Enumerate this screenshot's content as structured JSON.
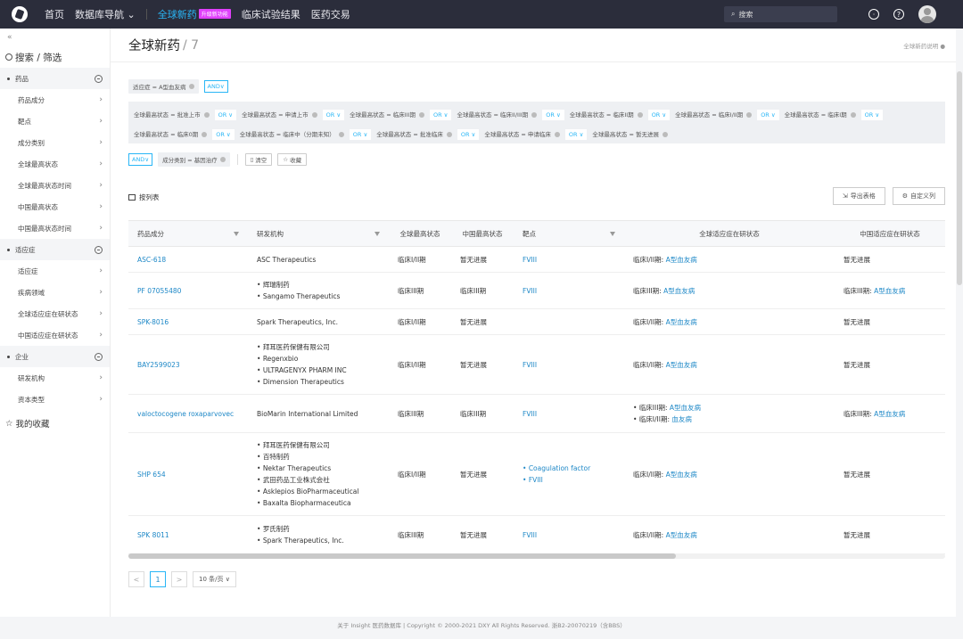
{
  "topnav": {
    "home": "首页",
    "db_nav": "数据库导航",
    "global_drugs": "全球新药",
    "upgrade_badge": "升级新功能",
    "clinical_results": "临床试验结果",
    "deals": "医药交易",
    "search_placeholder": "搜索"
  },
  "sidebar": {
    "collapse": "«",
    "search_title": "搜索 / 筛选",
    "groups": [
      {
        "label": "药品",
        "items": [
          "药品成分",
          "靶点",
          "成分类别",
          "全球最高状态",
          "全球最高状态时间",
          "中国最高状态",
          "中国最高状态时间"
        ]
      },
      {
        "label": "适应症",
        "items": [
          "适应症",
          "疾病领域",
          "全球适应症在研状态",
          "中国适应症在研状态"
        ]
      },
      {
        "label": "企业",
        "items": [
          "研发机构",
          "资本类型"
        ]
      }
    ],
    "favorites": "我的收藏"
  },
  "main": {
    "title": "全球新药",
    "count": "/ 7",
    "help": "全球新药说明",
    "filters": {
      "indication_chip": "适应症 = A型血友病",
      "and1": "AND",
      "status_chips": [
        "全球最高状态 = 批准上市",
        "全球最高状态 = 申请上市",
        "全球最高状态 = 临床III期",
        "全球最高状态 = 临床II/III期",
        "全球最高状态 = 临床II期",
        "全球最高状态 = 临床I/II期",
        "全球最高状态 = 临床I期",
        "全球最高状态 = 临床0期",
        "全球最高状态 = 临床中（分期未知）",
        "全球最高状态 = 批准临床",
        "全球最高状态 = 申请临床",
        "全球最高状态 = 暂无进展"
      ],
      "or_label": "OR",
      "and2": "AND",
      "category_chip": "成分类别 = 基因治疗",
      "clear": "清空",
      "save": "收藏"
    },
    "list_title": "按列表",
    "export": "导出表格",
    "customize": "自定义列",
    "columns": [
      "药品成分",
      "研发机构",
      "全球最高状态",
      "中国最高状态",
      "靶点",
      "全球适应症在研状态",
      "中国适应症在研状态"
    ],
    "rows": [
      {
        "drug": "ASC-618",
        "orgs": [
          "ASC Therapeutics"
        ],
        "global": "临床I/II期",
        "china": "暂无进展",
        "targets": [
          "FVIII"
        ],
        "gstatus": [
          {
            "phase": "临床I/II期:",
            "ind": "A型血友病"
          }
        ],
        "cstatus": {
          "phase": "暂无进展",
          "ind": ""
        }
      },
      {
        "drug": "PF 07055480",
        "orgs": [
          "辉瑞制药",
          "Sangamo Therapeutics"
        ],
        "global": "临床III期",
        "china": "临床III期",
        "targets": [
          "FVIII"
        ],
        "gstatus": [
          {
            "phase": "临床III期:",
            "ind": "A型血友病"
          }
        ],
        "cstatus": {
          "phase": "临床III期:",
          "ind": "A型血友病"
        }
      },
      {
        "drug": "SPK-8016",
        "orgs": [
          "Spark Therapeutics, Inc."
        ],
        "global": "临床I/II期",
        "china": "暂无进展",
        "targets": [],
        "gstatus": [
          {
            "phase": "临床I/II期:",
            "ind": "A型血友病"
          }
        ],
        "cstatus": {
          "phase": "暂无进展",
          "ind": ""
        }
      },
      {
        "drug": "BAY2599023",
        "orgs": [
          "拜耳医药保健有限公司",
          "Regenxbio",
          "ULTRAGENYX PHARM INC",
          "Dimension Therapeutics"
        ],
        "global": "临床I/II期",
        "china": "暂无进展",
        "targets": [
          "FVIII"
        ],
        "gstatus": [
          {
            "phase": "临床I/II期:",
            "ind": "A型血友病"
          }
        ],
        "cstatus": {
          "phase": "暂无进展",
          "ind": ""
        }
      },
      {
        "drug": "valoctocogene roxaparvovec",
        "orgs": [
          "BioMarin International Limited"
        ],
        "global": "临床III期",
        "china": "临床III期",
        "targets": [
          "FVIII"
        ],
        "gstatus": [
          {
            "phase": "临床III期:",
            "ind": "A型血友病"
          },
          {
            "phase": "临床I/II期:",
            "ind": "血友病"
          }
        ],
        "cstatus": {
          "phase": "临床III期:",
          "ind": "A型血友病"
        }
      },
      {
        "drug": "SHP 654",
        "orgs": [
          "拜耳医药保健有限公司",
          "百特制药",
          "Nektar Therapeutics",
          "武田药品工业株式会社",
          "Asklepios BioPharmaceutical",
          "Baxalta Biopharmaceutica"
        ],
        "global": "临床I/II期",
        "china": "暂无进展",
        "targets": [
          "Coagulation factor",
          "FVIII"
        ],
        "gstatus": [
          {
            "phase": "临床I/II期:",
            "ind": "A型血友病"
          }
        ],
        "cstatus": {
          "phase": "暂无进展",
          "ind": ""
        }
      },
      {
        "drug": "SPK 8011",
        "orgs": [
          "罗氏制药",
          "Spark Therapeutics, Inc."
        ],
        "global": "临床III期",
        "china": "暂无进展",
        "targets": [
          "FVIII"
        ],
        "gstatus": [
          {
            "phase": "临床I/II期:",
            "ind": "A型血友病"
          }
        ],
        "cstatus": {
          "phase": "暂无进展",
          "ind": ""
        }
      }
    ],
    "pager": {
      "prev": "<",
      "page": "1",
      "next": ">",
      "size": "10 条/页"
    }
  },
  "footer": "关于 Insight 医药数据库 | Copyright © 2000-2021 DXY All Rights Reserved. 浙B2-20070219（含BBS）"
}
